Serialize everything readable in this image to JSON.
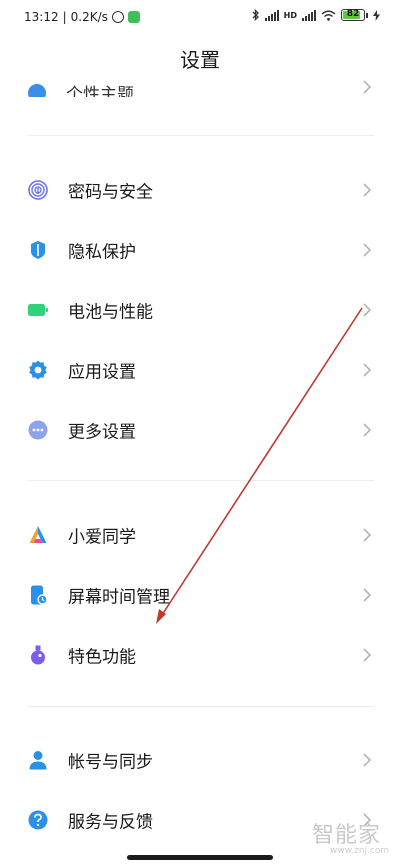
{
  "status_bar": {
    "time": "13:12",
    "network_speed": "0.2K/s",
    "separator": "|",
    "alarm_icon": "alarm-icon",
    "app_badge_icon": "app-notification-icon",
    "bluetooth_icon": "bluetooth-icon",
    "signal_icon": "signal-bars-icon",
    "hd_label": "HD",
    "wifi_icon": "wifi-icon",
    "battery_level": "82",
    "charging_icon": "lightning-icon"
  },
  "header": {
    "title": "设置"
  },
  "partial_item": {
    "label": "个性主题"
  },
  "groups": [
    {
      "items": [
        {
          "label": "密码与安全",
          "icon": "fingerprint-icon",
          "color": "#6f74e8"
        },
        {
          "label": "隐私保护",
          "icon": "privacy-shield-icon",
          "color": "#2a90e8"
        },
        {
          "label": "电池与性能",
          "icon": "battery-icon",
          "color": "#2fd37a"
        },
        {
          "label": "应用设置",
          "icon": "gear-icon",
          "color": "#2a90e8"
        },
        {
          "label": "更多设置",
          "icon": "more-dots-icon",
          "color": "#8ea4e8"
        }
      ]
    },
    {
      "items": [
        {
          "label": "小爱同学",
          "icon": "xiaoai-icon",
          "color": "#5b6cf0"
        },
        {
          "label": "屏幕时间管理",
          "icon": "screen-time-icon",
          "color": "#2a90e8"
        },
        {
          "label": "特色功能",
          "icon": "flask-icon",
          "color": "#7c5cf0"
        }
      ]
    },
    {
      "items": [
        {
          "label": "帐号与同步",
          "icon": "account-icon",
          "color": "#2a90e8"
        },
        {
          "label": "服务与反馈",
          "icon": "help-icon",
          "color": "#2a90e8"
        }
      ]
    }
  ],
  "watermark": {
    "text": "智能家",
    "url": "www.znj.com"
  },
  "colors": {
    "annotation_arrow": "#c0392b",
    "chevron": "#b5b5b5",
    "divider": "#ececec"
  }
}
